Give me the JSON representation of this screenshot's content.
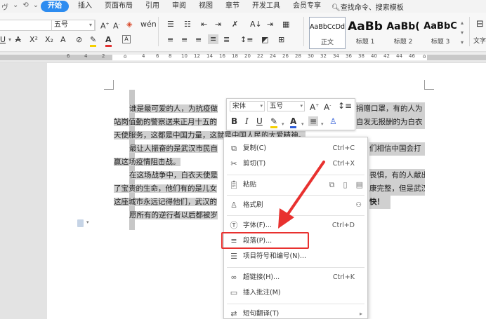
{
  "menubar": {
    "quick": [
      "ヴ",
      "⌄",
      "⟲",
      "⌄"
    ],
    "tabs": [
      "开始",
      "插入",
      "页面布局",
      "引用",
      "审阅",
      "视图",
      "章节",
      "开发工具",
      "会员专享"
    ],
    "active_tab": "开始",
    "search": "查找命令、搜索模板"
  },
  "ribbon": {
    "font_name": "",
    "font_size": "五号",
    "styles": [
      {
        "preview": "AaBbCcDd",
        "caption": "正文"
      },
      {
        "preview": "AaBb",
        "caption": "标题 1"
      },
      {
        "preview": "AaBb(",
        "caption": "标题 2"
      },
      {
        "preview": "AaBbC",
        "caption": "标题 3"
      }
    ],
    "right_label": "文字"
  },
  "ruler": {
    "numbers": [
      "6",
      "4",
      "2",
      "2",
      "4",
      "6",
      "8",
      "10",
      "12",
      "14",
      "16",
      "18",
      "20",
      "22",
      "24",
      "26",
      "28",
      "30",
      "32",
      "34",
      "36",
      "38",
      "40",
      "42",
      "44",
      "46"
    ]
  },
  "document": {
    "lines": [
      "谁是最可爱的人，为抗疫做",
      "站岗值勤的警察送来正月十五的",
      "天使服务，这都是中国力量，这就是中国人民的大爱精神。",
      "最让人振奋的是武汉市民自",
      "赢这场疫情阻击战。",
      "在这场战争中，白衣天使是",
      "了宝贵的生命，他们有的是儿女",
      "这座城市永远记得他们，武汉的",
      "愿所有的逆行者以后都被岁"
    ],
    "right_fragments": {
      "l1": "捐赠口罩，有的人为",
      "l2": "自发无报酬的为白衣",
      "l4": "们相信中国会打",
      "l6": "畏惧，有的人献出",
      "l7": "康完整，但是武汉",
      "l9": "快！"
    }
  },
  "mini_toolbar": {
    "font": "宋体",
    "size": "五号",
    "bold": "B",
    "italic": "I"
  },
  "context_menu": {
    "items": [
      {
        "label": "复制(C)",
        "shortcut": "Ctrl+C",
        "icon": "copy-icon"
      },
      {
        "label": "剪切(T)",
        "shortcut": "Ctrl+X",
        "icon": "cut-icon"
      },
      {
        "label": "粘贴",
        "shortcut": "",
        "icon": "paste-icon"
      },
      {
        "label": "格式刷",
        "shortcut": "",
        "icon": "format-painter-icon"
      },
      {
        "label": "字体(F)...",
        "shortcut": "Ctrl+D",
        "icon": "font-icon"
      },
      {
        "label": "段落(P)...",
        "shortcut": "",
        "icon": "paragraph-icon"
      },
      {
        "label": "项目符号和编号(N)...",
        "shortcut": "",
        "icon": "bullets-icon"
      },
      {
        "label": "超链接(H)...",
        "shortcut": "Ctrl+K",
        "icon": "hyperlink-icon"
      },
      {
        "label": "插入批注(M)",
        "shortcut": "",
        "icon": "comment-icon"
      },
      {
        "label": "短句翻译(T)",
        "shortcut": "",
        "icon": "translate-icon"
      }
    ]
  },
  "colors": {
    "accent": "#2d8cf0",
    "annotation": "#e8312f",
    "selection": "#d0d0d0"
  }
}
